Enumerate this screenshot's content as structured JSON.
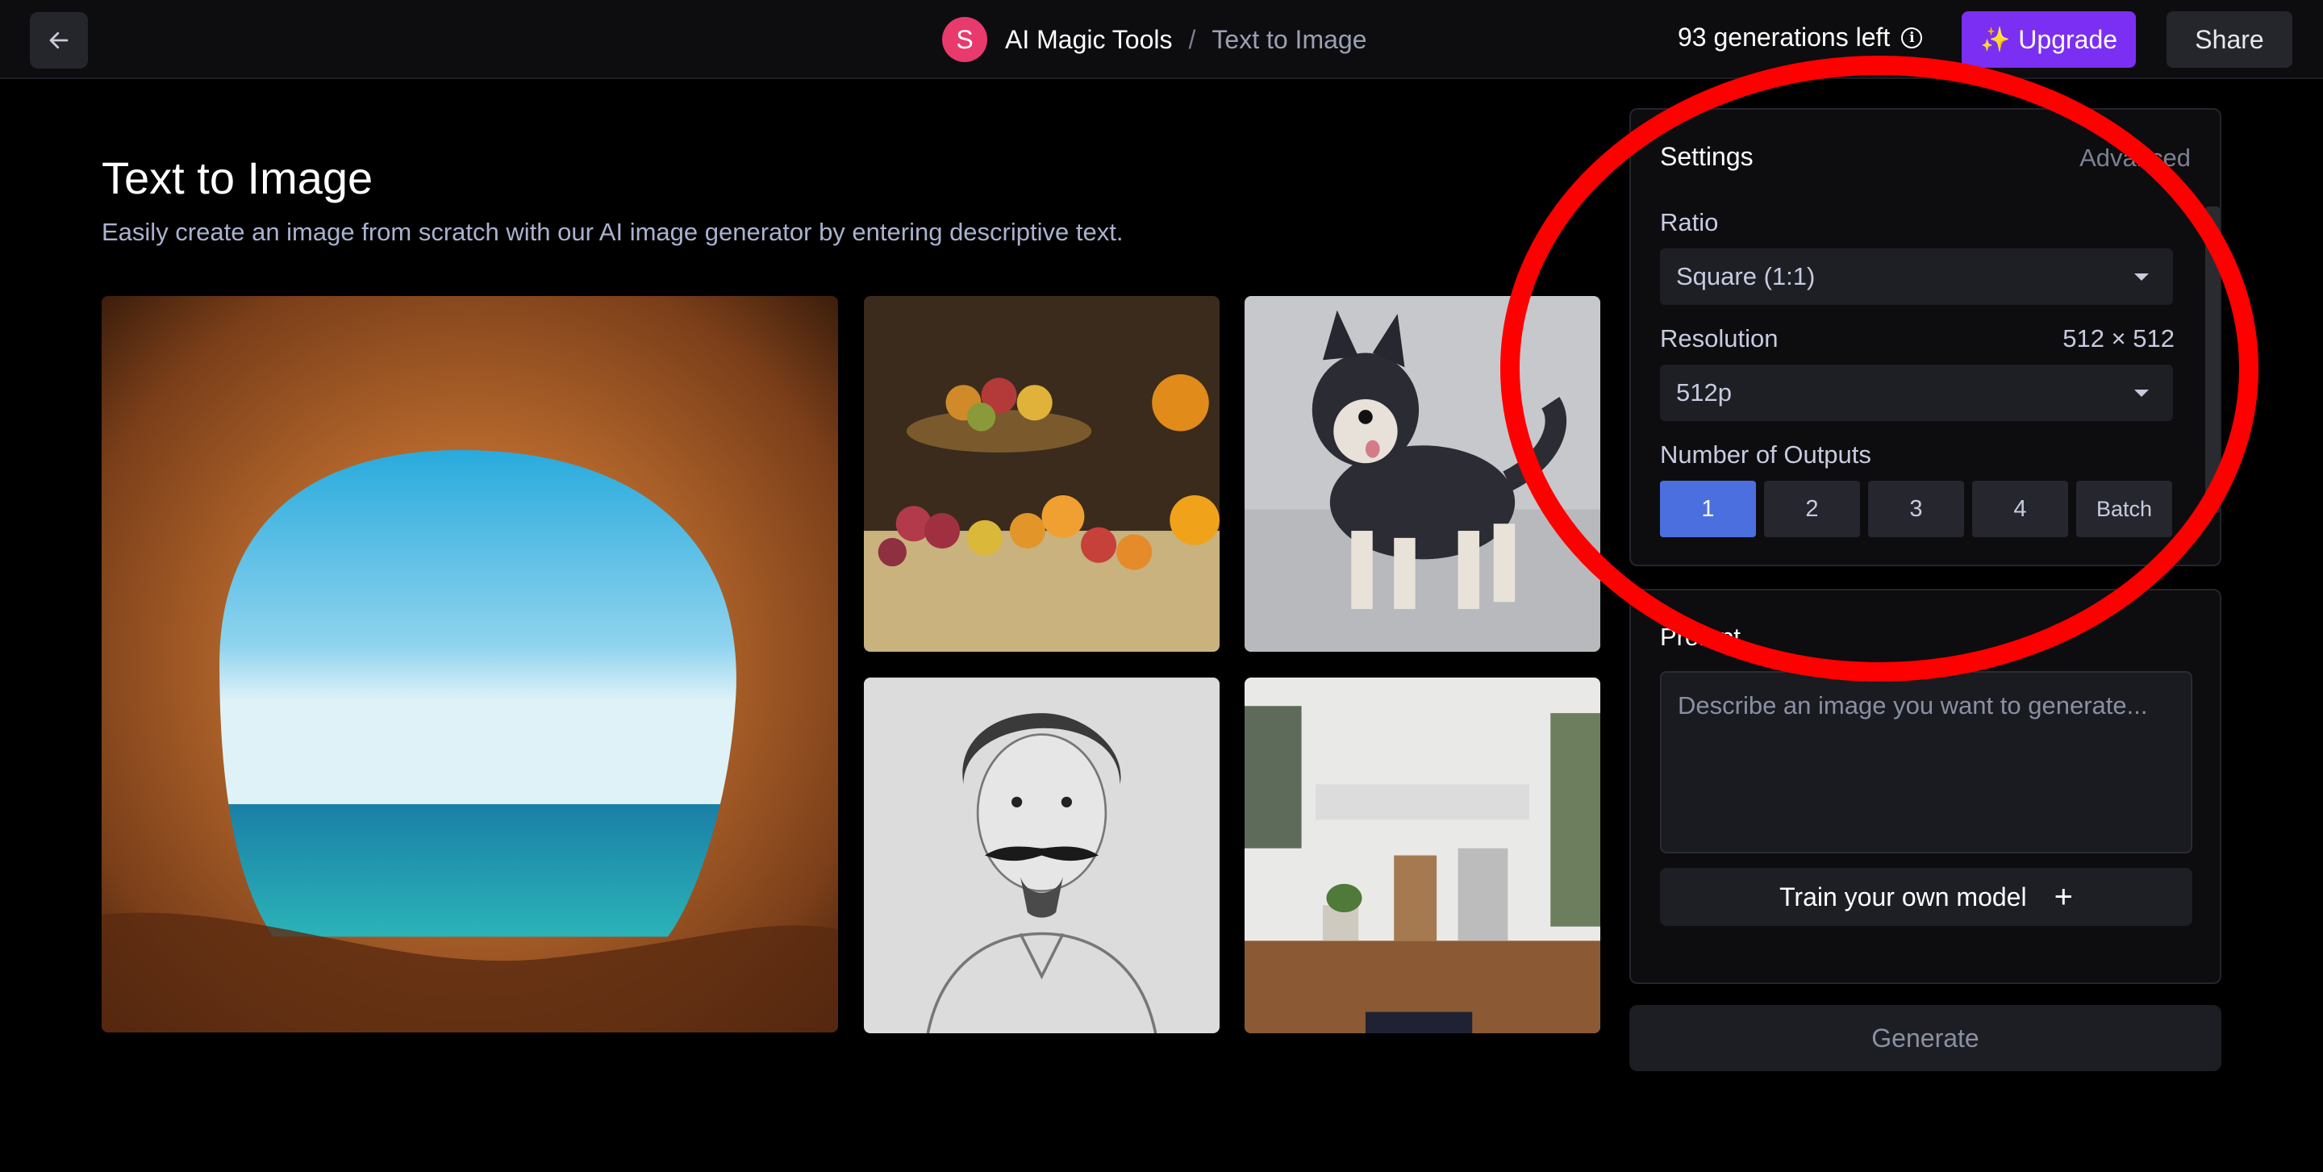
{
  "header": {
    "avatar_letter": "S",
    "app_name": "AI Magic Tools",
    "separator": "/",
    "current_page": "Text to Image",
    "generations_left": "93 generations left",
    "upgrade_label": "Upgrade",
    "share_label": "Share",
    "icons": [
      "arrow-left-icon",
      "info-icon",
      "sparkles-icon"
    ]
  },
  "main": {
    "title": "Text to Image",
    "subtitle": "Easily create an image from scratch with our AI image generator by entering descriptive text."
  },
  "settings": {
    "title": "Settings",
    "advanced_label": "Advanced",
    "ratio_label": "Ratio",
    "ratio_value": "Square (1:1)",
    "resolution_label": "Resolution",
    "resolution_dims": "512 × 512",
    "resolution_value": "512p",
    "outputs_label": "Number of Outputs",
    "outputs": [
      "1",
      "2",
      "3",
      "4",
      "Batch"
    ],
    "outputs_selected": "1"
  },
  "prompt": {
    "label": "Prompt",
    "placeholder": "Describe an image you want to generate...",
    "train_label": "Train your own model"
  },
  "generate_label": "Generate",
  "colors": {
    "accent": "#4c6fe0",
    "upgrade": "#7b2ff2",
    "avatar": "#e83a6d",
    "annotation": "#ff0000"
  }
}
